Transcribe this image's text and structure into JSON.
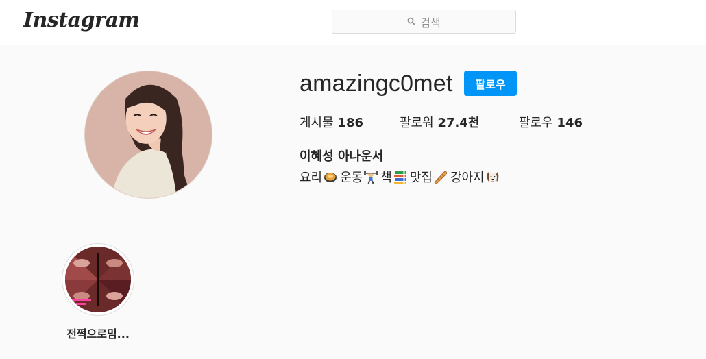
{
  "header": {
    "logo": "Instagram",
    "search_placeholder": "검색"
  },
  "profile": {
    "username": "amazingc0met",
    "follow_label": "팔로우",
    "stats": {
      "posts_label": "게시물",
      "posts_value": "186",
      "followers_label": "팔로워",
      "followers_value": "27.4천",
      "following_label": "팔로우",
      "following_value": "146"
    },
    "full_name": "이혜성 아나운서",
    "bio": [
      {
        "text": "요리",
        "icon": "cooking-pan-icon"
      },
      {
        "text": " 운동",
        "icon": "weight-lifter-icon"
      },
      {
        "text": " 책",
        "icon": "books-icon"
      },
      {
        "text": " 맛집",
        "icon": "baguette-icon"
      },
      {
        "text": "강아지",
        "icon": "dog-face-icon"
      }
    ]
  },
  "highlights": [
    {
      "label": "전쩍으로밈..."
    }
  ],
  "colors": {
    "accent": "#0095f6",
    "text": "#262626",
    "muted": "#8e8e8e",
    "border": "#dbdbdb",
    "background": "#fafafa"
  }
}
